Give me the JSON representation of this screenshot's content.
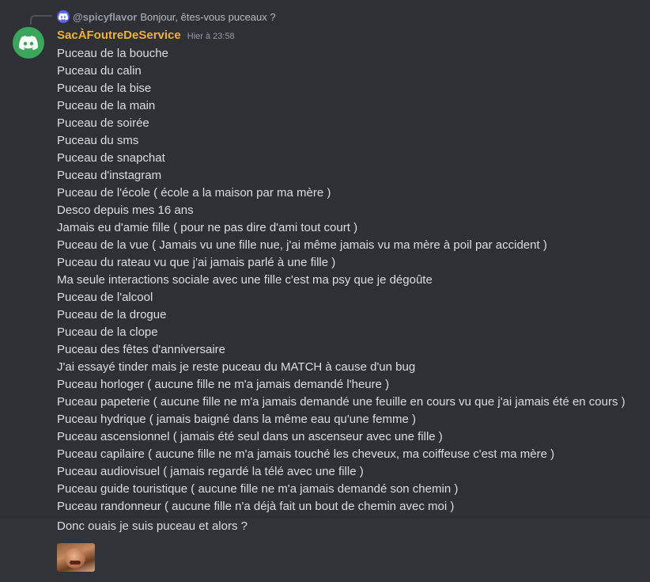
{
  "reply": {
    "author": "@spicyflavor",
    "text": "Bonjour, êtes-vous puceaux ?",
    "avatar_icon": "discord-blue-avatar"
  },
  "message": {
    "username": "SacÀFoutreDeService",
    "timestamp": "Hier à 23:58",
    "username_color": "#f0b232",
    "avatar_color": "#3ba55c",
    "avatar_icon": "discord-logo-icon",
    "lines": [
      "Puceau de la bouche",
      "Puceau du calin",
      "Puceau de la bise",
      "Puceau de la main",
      "Puceau de soirée",
      "Puceau du sms",
      "Puceau de snapchat",
      "Puceau d'instagram",
      "Puceau de l'école ( école a la maison par ma mère )",
      "Desco depuis mes 16 ans",
      "Jamais eu d'amie fille ( pour ne pas dire d'ami tout court )",
      "Puceau de la vue ( Jamais vu une fille nue, j'ai même jamais vu ma mère à poil par accident )",
      "Puceau du rateau vu que j'ai jamais parlé à une fille )",
      "Ma seule interactions sociale avec une fille c'est ma psy que je dégoûte",
      "Puceau de l'alcool",
      "Puceau de la drogue",
      "Puceau de la clope",
      "Puceau des fêtes d'anniversaire",
      "J'ai essayé tinder mais je reste puceau du MATCH à cause d'un bug",
      "Puceau horloger ( aucune fille ne m'a jamais demandé l'heure )",
      "Puceau papeterie ( aucune fille ne m'a jamais demandé une feuille en cours vu que j'ai jamais été en cours )",
      "Puceau hydrique ( jamais baigné dans la même eau qu'une femme )",
      "Puceau ascensionnel ( jamais été seul dans un ascenseur avec une fille )",
      "Puceau capilaire ( aucune fille ne m'a jamais touché les cheveux, ma coiffeuse c'est ma mère )",
      "Puceau audiovisuel ( jamais regardé la télé avec une fille )",
      "Puceau guide touristique ( aucune fille ne m'a jamais demandé son chemin )",
      "Puceau randonneur ( aucune fille n'a déjà fait un bout de chemin avec moi )"
    ]
  },
  "followup": {
    "text": "Donc ouais je suis puceau et alors ?",
    "emoji_icon": "custom-emoji-face"
  }
}
